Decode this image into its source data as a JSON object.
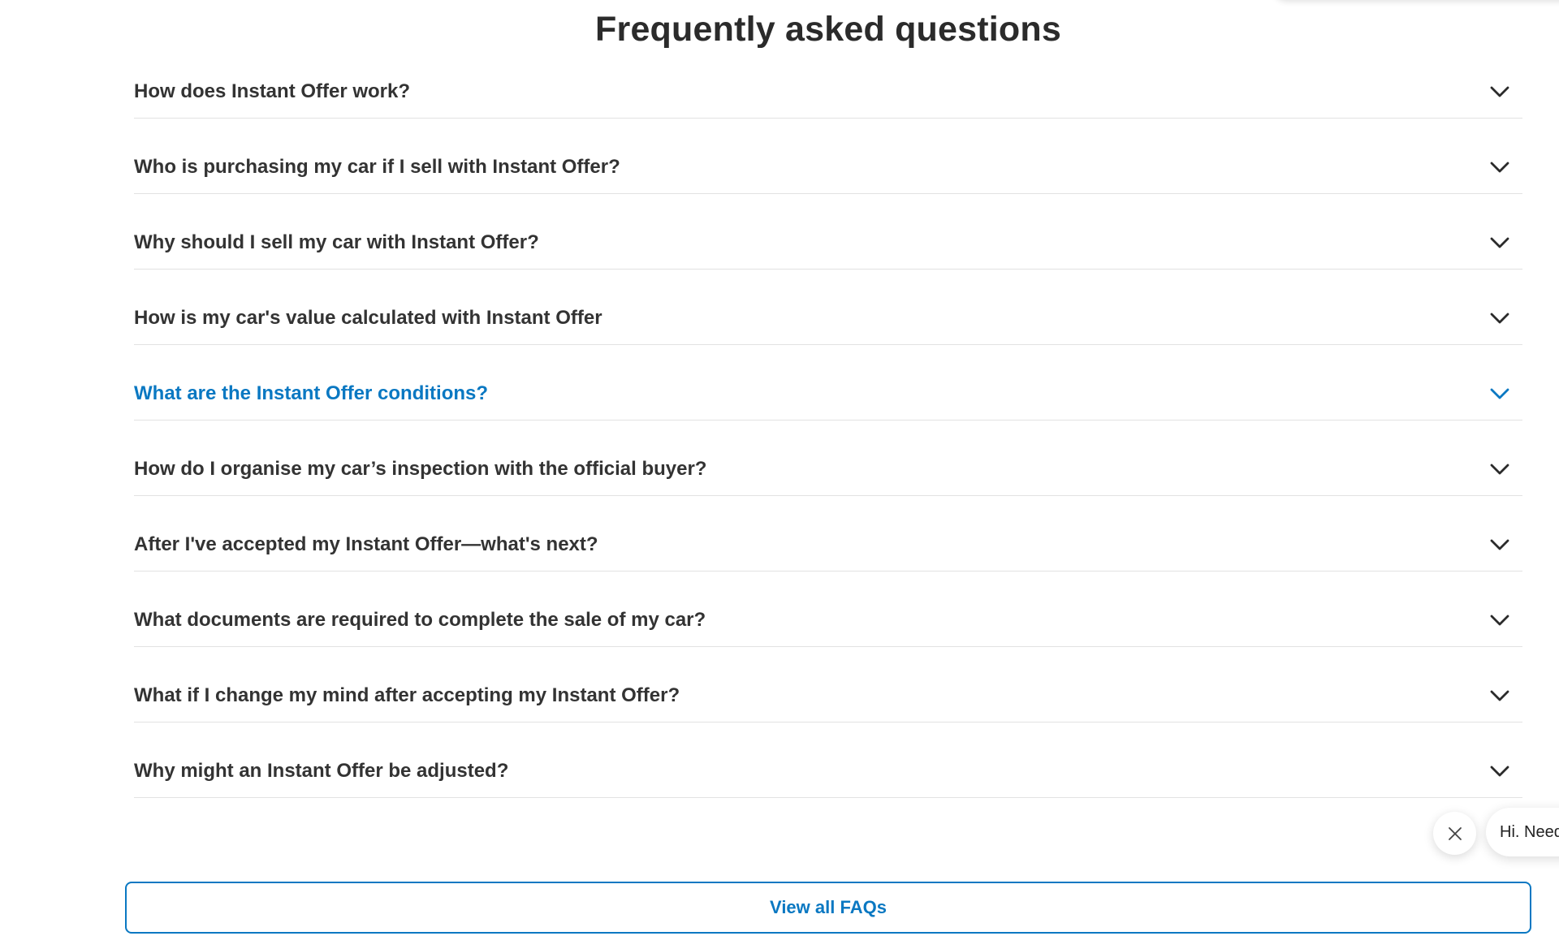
{
  "faq": {
    "title": "Frequently asked questions",
    "items": [
      {
        "question": "How does Instant Offer work?"
      },
      {
        "question": "Who is purchasing my car if I sell with Instant Offer?"
      },
      {
        "question": "Why should I sell my car with Instant Offer?"
      },
      {
        "question": "How is my car's value calculated with Instant Offer"
      },
      {
        "question": "What are the Instant Offer conditions?"
      },
      {
        "question": "How do I organise my car’s inspection with the official buyer?"
      },
      {
        "question": "After I've accepted my Instant Offer—what's next?"
      },
      {
        "question": "What documents are required to complete the sale of my car?"
      },
      {
        "question": "What if I change my mind after accepting my Instant Offer?"
      },
      {
        "question": "Why might an Instant Offer be adjusted?"
      }
    ],
    "active_index": 4,
    "view_all_label": "View all FAQs"
  },
  "chat": {
    "greeting": "Hi. Need",
    "close_icon": "close-icon"
  },
  "colors": {
    "accent": "#0a78c2",
    "text": "#333333",
    "divider": "#e2e2e2"
  },
  "icons": {
    "expand": "chevron-down-icon"
  }
}
